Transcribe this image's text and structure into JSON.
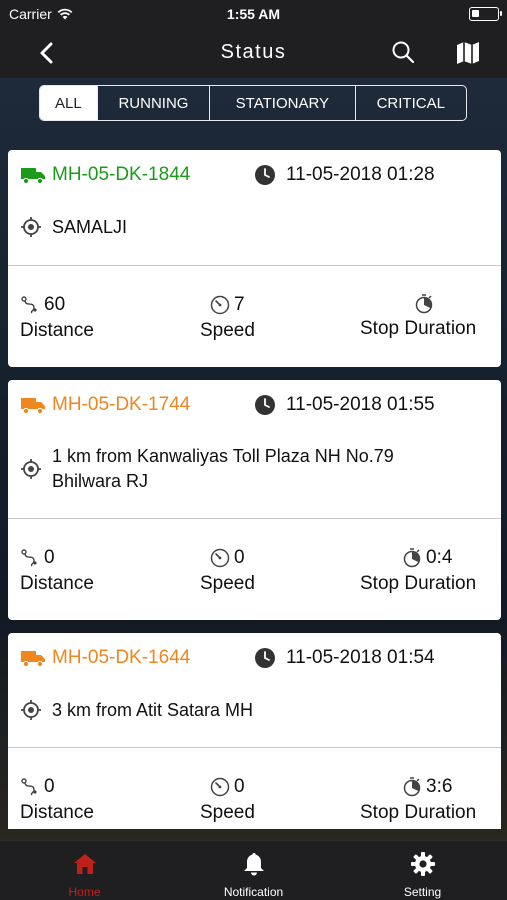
{
  "status_bar": {
    "carrier": "Carrier",
    "time": "1:55 AM"
  },
  "nav": {
    "title": "Status"
  },
  "segments": [
    "ALL",
    "RUNNING",
    "STATIONARY",
    "CRITICAL"
  ],
  "active_segment": "ALL",
  "colors": {
    "green": "#1a9c1a",
    "orange": "#f0861e",
    "active_tab": "#c0201b"
  },
  "vehicles": [
    {
      "plate": "MH-05-DK-1844",
      "status_color": "green",
      "datetime": "11-05-2018 01:28",
      "location_line1": "SAMALJI",
      "location_line2": "",
      "distance": "60",
      "speed": "7",
      "stop_duration": "",
      "distance_label": "Distance",
      "speed_label": "Speed",
      "stop_label": "Stop Duration"
    },
    {
      "plate": "MH-05-DK-1744",
      "status_color": "orange",
      "datetime": "11-05-2018 01:55",
      "location_line1": "1 km from Kanwaliyas Toll Plaza NH No.79",
      "location_line2": "Bhilwara  RJ",
      "distance": "0",
      "speed": "0",
      "stop_duration": "0:4",
      "distance_label": "Distance",
      "speed_label": "Speed",
      "stop_label": "Stop Duration"
    },
    {
      "plate": "MH-05-DK-1644",
      "status_color": "orange",
      "datetime": "11-05-2018 01:54",
      "location_line1": "3 km from Atit Satara MH",
      "location_line2": "",
      "distance": "0",
      "speed": "0",
      "stop_duration": "3:6",
      "distance_label": "Distance",
      "speed_label": "Speed",
      "stop_label": "Stop Duration"
    }
  ],
  "tabs": [
    {
      "label": "Home",
      "icon": "home-icon",
      "active": true
    },
    {
      "label": "Notification",
      "icon": "bell-icon",
      "active": false
    },
    {
      "label": "Setting",
      "icon": "gear-icon",
      "active": false
    }
  ]
}
